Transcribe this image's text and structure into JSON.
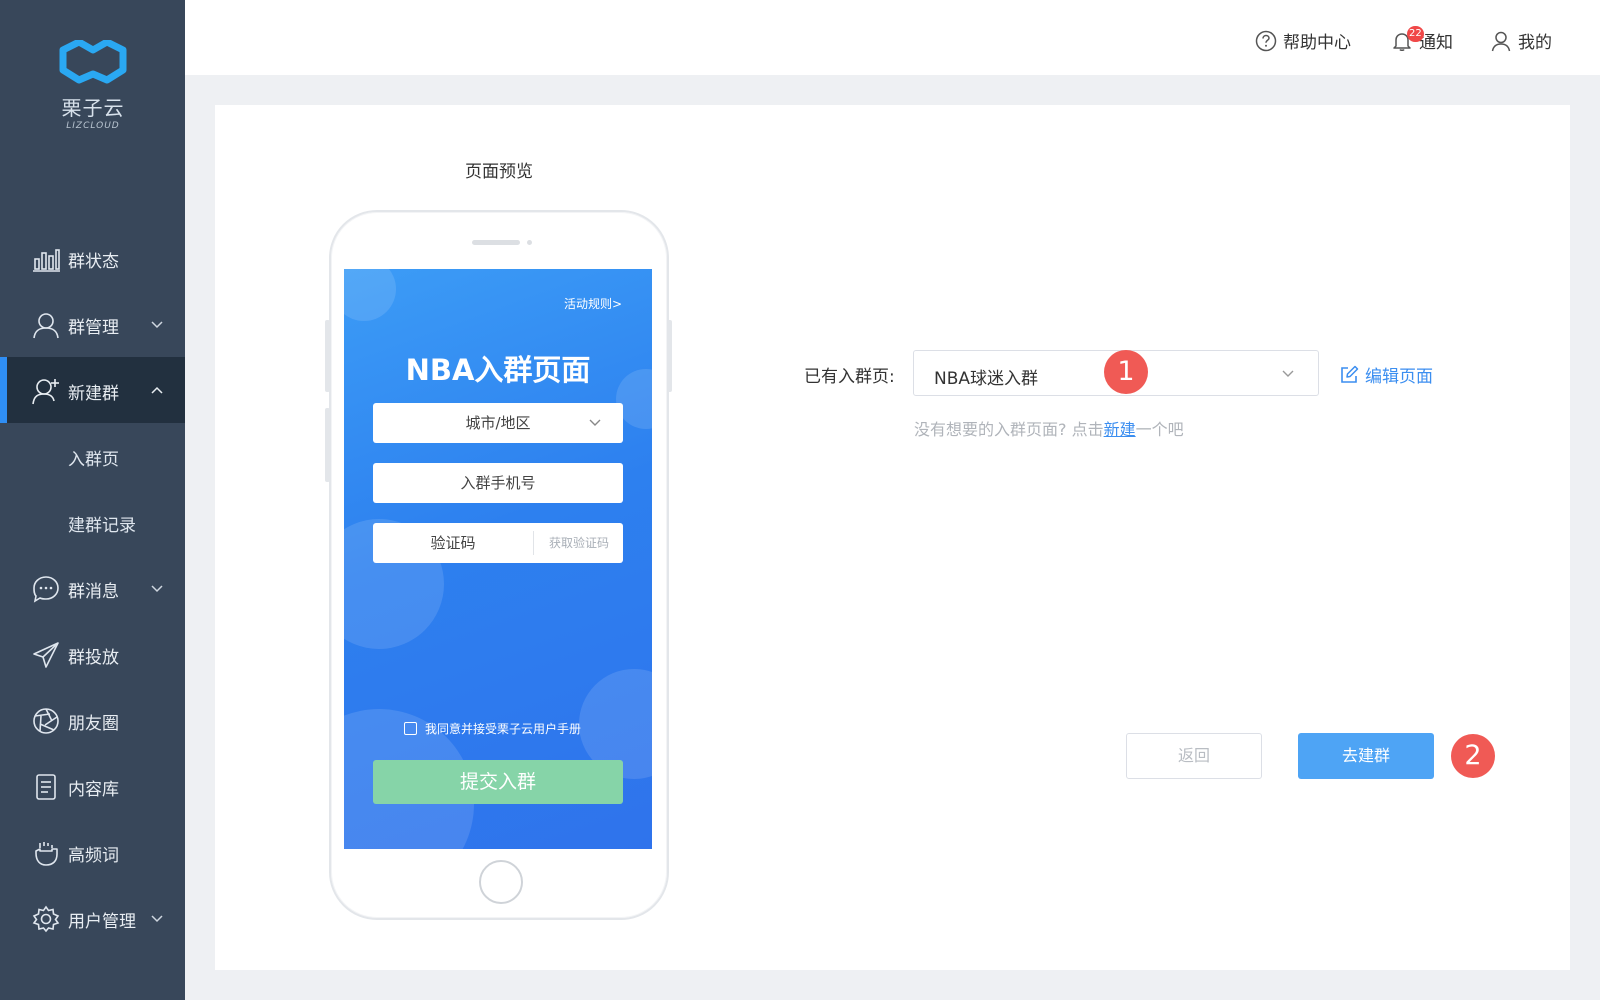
{
  "app": {
    "logo_text": "栗子云",
    "logo_sub": "LIZCLOUD",
    "brand_color": "#2f8ef4"
  },
  "sidebar": {
    "items": [
      {
        "label": "群状态",
        "icon": "bar-chart-icon"
      },
      {
        "label": "群管理",
        "icon": "user-icon",
        "expandable": true
      },
      {
        "label": "新建群",
        "icon": "add-user-icon",
        "expandable": true,
        "active": true
      },
      {
        "label": "群消息",
        "icon": "chat-icon",
        "expandable": true
      },
      {
        "label": "群投放",
        "icon": "send-icon"
      },
      {
        "label": "朋友圈",
        "icon": "aperture-icon"
      },
      {
        "label": "内容库",
        "icon": "document-icon"
      },
      {
        "label": "高频词",
        "icon": "hand-icon"
      },
      {
        "label": "用户管理",
        "icon": "gear-icon",
        "expandable": true
      }
    ],
    "sub_items": [
      {
        "label": "入群页"
      },
      {
        "label": "建群记录"
      }
    ]
  },
  "header": {
    "help": "帮助中心",
    "notify": "通知",
    "notify_count": "22",
    "mine": "我的"
  },
  "preview": {
    "title": "页面预览",
    "rules_link": "活动规则>",
    "screen_title": "NBA入群页面",
    "city_field": "城市/地区",
    "phone_field": "入群手机号",
    "code_field": "验证码",
    "get_code": "获取验证码",
    "agreement": "我同意并接受栗子云用户手册",
    "submit": "提交入群"
  },
  "form": {
    "label": "已有入群页:",
    "selected": "NBA球迷入群",
    "edit_link": "编辑页面",
    "hint_before": "没有想要的入群页面? 点击",
    "hint_link": "新建",
    "hint_after": "一个吧",
    "marker1": "1",
    "marker2": "2",
    "back_button": "返回",
    "go_button": "去建群"
  }
}
